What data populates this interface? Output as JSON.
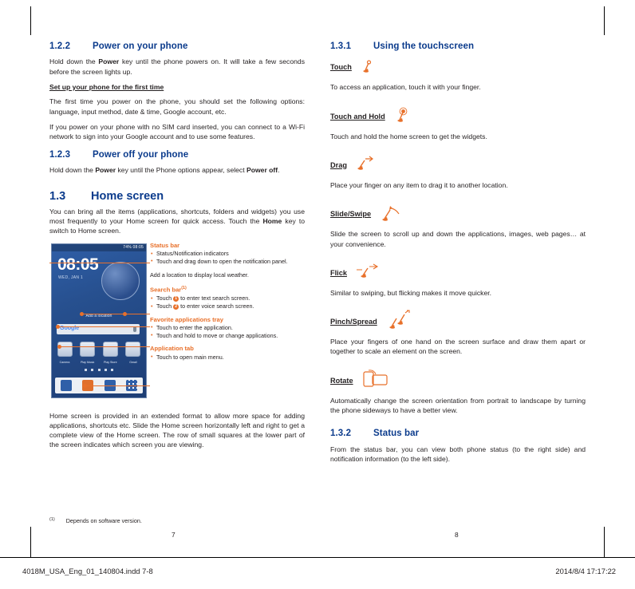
{
  "document": {
    "footer_filename": "4018M_USA_Eng_01_140804.indd   7-8",
    "footer_timestamp": "2014/8/4   17:17:22",
    "page_left": "7",
    "page_right": "8",
    "footnote_marker": "(1)",
    "footnote_text": "Depends on software version."
  },
  "left_column": {
    "s122": {
      "number": "1.2.2",
      "title": "Power on your phone",
      "p1_pre": "Hold down the ",
      "p1_bold": "Power",
      "p1_post": " key until the phone powers on. It will take a few seconds before the screen lights up.",
      "sub_head": "Set up your phone for the first time",
      "p2": "The first time you power on the phone, you should set the following options: language, input method, date & time, Google account, etc.",
      "p3": "If you power on your phone with no SIM card inserted, you can connect to a Wi-Fi network to sign into your Google account and to use some features."
    },
    "s123": {
      "number": "1.2.3",
      "title": "Power off your phone",
      "p1_pre": "Hold down the ",
      "p1_bold1": "Power",
      "p1_mid": " key until the Phone options appear, select ",
      "p1_bold2": "Power off",
      "p1_post": "."
    },
    "s13": {
      "number": "1.3",
      "title": "Home screen",
      "p1_pre": "You can bring all the items (applications, shortcuts, folders and widgets) you use most frequently to your Home screen for quick access. Touch the ",
      "p1_bold": "Home",
      "p1_post": " key to switch to Home screen.",
      "p_after": "Home screen is provided in an extended format to allow more space for adding applications, shortcuts etc. Slide the Home screen horizontally left and right to get a complete view of the Home screen. The row of small squares at the lower part of the screen indicates which screen you are viewing."
    },
    "phone": {
      "status_text": "74%  08:05",
      "clock": "08:05",
      "date": "WED, JAN 1",
      "add_location": "Add a location",
      "search_hint": "Google",
      "apps": [
        {
          "label": "Camera"
        },
        {
          "label": "Play Music"
        },
        {
          "label": "Play Store"
        },
        {
          "label": "Gmail"
        }
      ],
      "dots": 5,
      "tray_items": [
        "phone",
        "contacts",
        "messaging",
        "all-apps"
      ]
    },
    "callouts": [
      {
        "title": "Status bar",
        "items": [
          "Status/Notification indicators",
          "Touch and drag down to open the notification panel."
        ]
      },
      {
        "plain": "Add a location to display local weather."
      },
      {
        "title": "Search bar",
        "sup": "(1)",
        "items_rich": [
          {
            "pre": "Touch ",
            "badge": "1",
            "post": " to enter text search screen."
          },
          {
            "pre": "Touch ",
            "badge": "2",
            "post": " to enter voice search screen."
          }
        ]
      },
      {
        "title": "Favorite applications tray",
        "items": [
          "Touch to enter the application.",
          "Touch and hold to move or change applications."
        ]
      },
      {
        "title": "Application tab",
        "items": [
          "Touch to open main menu."
        ]
      }
    ]
  },
  "right_column": {
    "s131": {
      "number": "1.3.1",
      "title": "Using the touchscreen"
    },
    "gestures": [
      {
        "name": "Touch",
        "icon": "touch-icon",
        "desc": "To access an application, touch it with your finger."
      },
      {
        "name": "Touch and Hold",
        "icon": "touch-and-hold-icon",
        "desc": "Touch and hold the home screen to get the widgets."
      },
      {
        "name": "Drag",
        "icon": "drag-icon",
        "desc": "Place your finger on any item to drag it to another location."
      },
      {
        "name": "Slide/Swipe",
        "icon": "slide-swipe-icon",
        "desc": "Slide the screen to scroll up and down the applications, images, web pages… at your convenience."
      },
      {
        "name": "Flick",
        "icon": "flick-icon",
        "desc": "Similar to swiping, but flicking makes it move quicker."
      },
      {
        "name": "Pinch/Spread",
        "icon": "pinch-spread-icon",
        "desc": "Place your fingers of one hand on the screen surface and draw them apart or together to scale an element on the screen."
      },
      {
        "name": "Rotate",
        "icon": "rotate-icon",
        "desc": "Automatically change the screen orientation from portrait to landscape by turning the phone sideways to have a better view."
      }
    ],
    "s132": {
      "number": "1.3.2",
      "title": "Status bar",
      "p1": "From the status bar, you can view both phone status (to the right side) and notification information (to the left side)."
    }
  },
  "colors": {
    "heading_blue": "#0b3b8c",
    "accent_orange": "#e8702a",
    "body": "#231f20"
  }
}
